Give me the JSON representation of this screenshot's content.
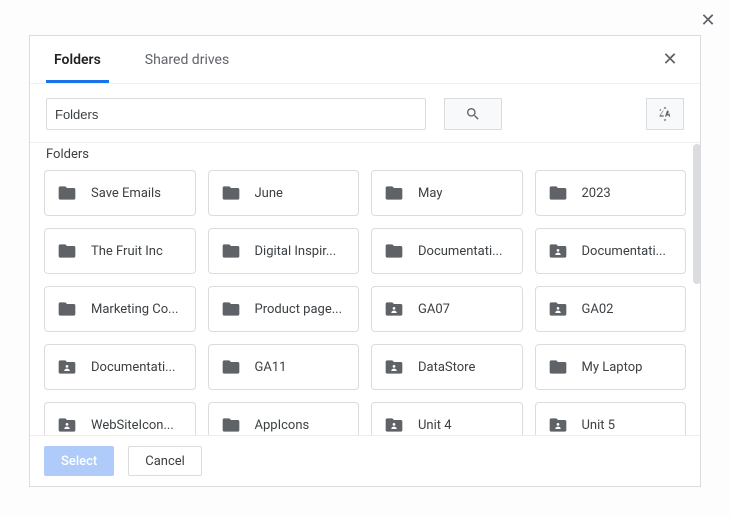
{
  "outer_close_glyph": "✕",
  "tabs": {
    "folders": "Folders",
    "shared_drives": "Shared drives",
    "close_glyph": "✕"
  },
  "search": {
    "value": "Folders"
  },
  "section_label": "Folders",
  "folders": [
    {
      "label": "Save Emails",
      "shared": false
    },
    {
      "label": "June",
      "shared": false
    },
    {
      "label": "May",
      "shared": false
    },
    {
      "label": "2023",
      "shared": false
    },
    {
      "label": "The Fruit Inc",
      "shared": false
    },
    {
      "label": "Digital Inspir...",
      "shared": false
    },
    {
      "label": "Documentati...",
      "shared": false
    },
    {
      "label": "Documentati...",
      "shared": true
    },
    {
      "label": "Marketing Co...",
      "shared": false
    },
    {
      "label": "Product page...",
      "shared": false
    },
    {
      "label": "GA07",
      "shared": true
    },
    {
      "label": "GA02",
      "shared": true
    },
    {
      "label": "Documentati...",
      "shared": true
    },
    {
      "label": "GA11",
      "shared": false
    },
    {
      "label": "DataStore",
      "shared": true
    },
    {
      "label": "My Laptop",
      "shared": false
    },
    {
      "label": "WebSiteIcon...",
      "shared": true
    },
    {
      "label": "AppIcons",
      "shared": false
    },
    {
      "label": "Unit 4",
      "shared": true
    },
    {
      "label": "Unit 5",
      "shared": true
    }
  ],
  "footer": {
    "select": "Select",
    "cancel": "Cancel"
  }
}
